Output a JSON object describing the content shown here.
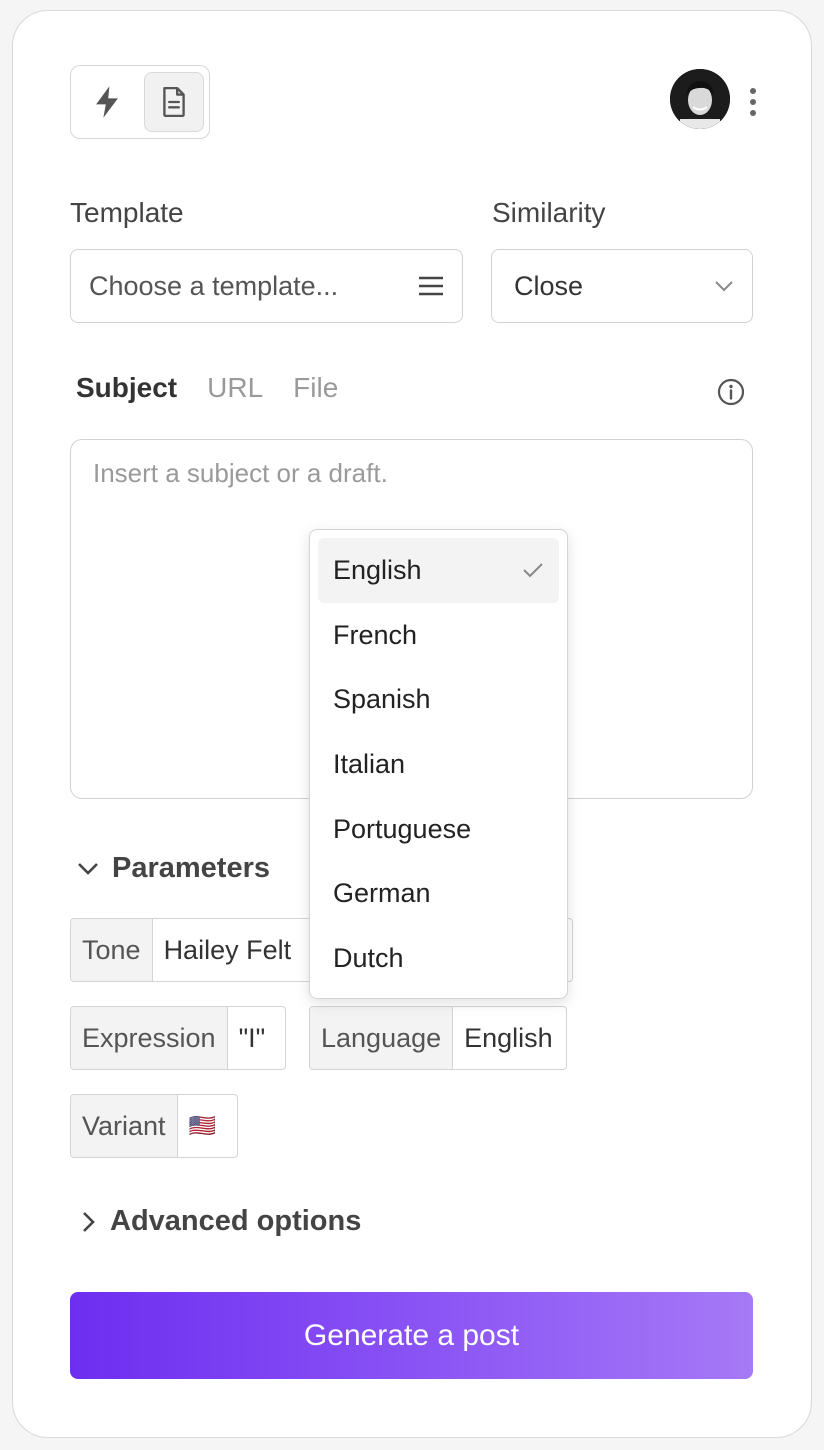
{
  "header": {
    "mode_icons": [
      "lightning-icon",
      "document-icon"
    ],
    "active_mode": "document-icon"
  },
  "template": {
    "label": "Template",
    "placeholder": "Choose a template..."
  },
  "similarity": {
    "label": "Similarity",
    "value": "Close"
  },
  "source_tabs": [
    {
      "label": "Subject",
      "active": true
    },
    {
      "label": "URL",
      "active": false
    },
    {
      "label": "File",
      "active": false
    }
  ],
  "subject": {
    "placeholder": "Insert a subject or a draft."
  },
  "parameters": {
    "title": "Parameters",
    "tone": {
      "key": "Tone",
      "value": "Hailey Felt"
    },
    "expression": {
      "key": "Expression",
      "value": "\"I\""
    },
    "language": {
      "key": "Language",
      "value": "English"
    },
    "variant": {
      "key": "Variant",
      "value": "🇺🇸"
    }
  },
  "language_dropdown": {
    "options": [
      "English",
      "French",
      "Spanish",
      "Italian",
      "Portuguese",
      "German",
      "Dutch"
    ],
    "selected": "English"
  },
  "advanced": {
    "title": "Advanced options"
  },
  "generate_button": {
    "label": "Generate a post"
  },
  "colors": {
    "accent_start": "#6d2ef0",
    "accent_end": "#a679f6"
  }
}
